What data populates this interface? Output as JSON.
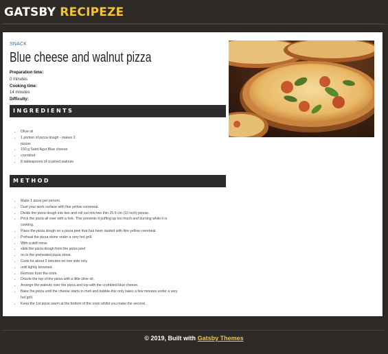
{
  "header": {
    "brand_part1": "GATSBY",
    "brand_part2": "RECIPEZE"
  },
  "recipe": {
    "category": "SNACK",
    "title": "Blue cheese and walnut pizza",
    "prep_label": "Preparation time",
    "prep_value": "0 minutes",
    "cook_label": "Cooking time",
    "cook_value": "14 minutes",
    "difficulty_label": "Difficulty",
    "ingredients_heading": "INGREDIENTS",
    "ingredients": [
      "Olive oil",
      "1 portion of pizza dough - makes 2 pizzas",
      "150 g Saint Agur Blue cheese",
      "crumbled",
      "8 tablespoons of crushed walnuts"
    ],
    "method_heading": "METHOD",
    "method": [
      "Make 1 pizza per person.",
      "Dust your work surface with fine yellow cornmeal.",
      "Divide the pizza dough into two and roll out into two thin 25.5 cm (10 inch) pizzas.",
      "Prick the pizza all over with a fork. This prevents it puffing up too much and burning while it is cooking.",
      "Place the pizza dough on a pizza peel that has been dusted with fine yellow cornmeal.",
      "Preheat the pizza stone under a very hot grill.",
      "With a deft move",
      "slide the pizza dough from the pizza peel",
      "on to the preheated pizza stone.",
      "Cook for about 2 minutes on one side only",
      "until lightly browned.",
      "Remove from the oven.",
      "Drizzle the top of the pizza with a little olive oil.",
      "Arrange the walnuts over the pizza and top with the crumbled blue cheese.",
      "Bake the pizza until the cheese starts to melt and bubble-this only takes a few minutes under a very hot grill.",
      "Keep the 1st pizza warm at the bottom of the oven whilst you make the second."
    ],
    "image_subject": "pizza-photo"
  },
  "footer": {
    "prefix": "© 2019, Built with",
    "link": "Gatsby Themes"
  },
  "colors": {
    "background": "#2e2a27",
    "accent": "#f4c430",
    "bar": "#2b2b2b",
    "link": "#1a6fb3"
  }
}
